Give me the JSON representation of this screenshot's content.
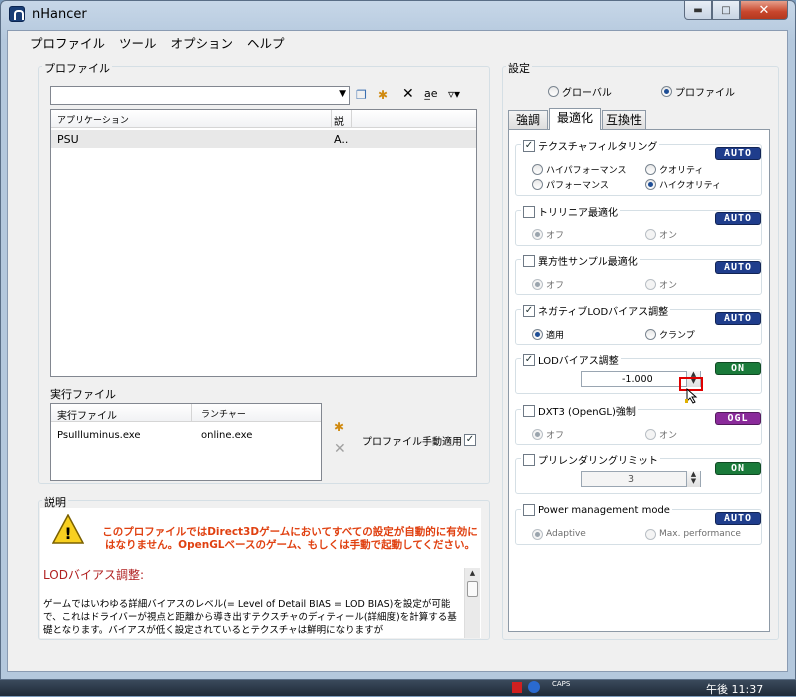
{
  "window": {
    "title": "nHancer"
  },
  "menu": [
    "プロファイル",
    "ツール",
    "オプション",
    "ヘルプ"
  ],
  "profile": {
    "group_label": "プロファイル",
    "combo_value": "",
    "columns": [
      "アプリケーション",
      "説"
    ],
    "rows": [
      {
        "app": "PSU",
        "desc": "A.."
      }
    ]
  },
  "exec": {
    "group_label": "実行ファイル",
    "columns": [
      "実行ファイル",
      "ランチャー"
    ],
    "rows": [
      {
        "file": "PsuIlluminus.exe",
        "launcher": "online.exe"
      }
    ],
    "auto_apply_label": "プロファイル手動適用",
    "auto_apply_checked": true
  },
  "desc": {
    "group_label": "説明",
    "warning": "このプロファイルではDirect3Dゲームにおいてすべての設定が自動的に有効に\nはなりません。OpenGLベースのゲーム、もしくは手動で起動してください。",
    "heading": "LODバイアス調整:",
    "body": "ゲームではいわゆる詳細バイアスのレベル(= Level of Detail BIAS = LOD BIAS)を設定が可能で、これはドライバーが視点と距離から導き出すテクスチャのディティール(詳細度)を計算する基礎となります。バイアスが低く設定されているとテクスチャは鮮明になりますが"
  },
  "settings": {
    "group_label": "設定",
    "scope_global": "グローバル",
    "scope_profile": "プロファイル",
    "scope_selected": "profile",
    "tabs": [
      "強調",
      "最適化",
      "互換性"
    ],
    "active_tab": "最適化"
  },
  "sections": {
    "texfilter": {
      "label": "テクスチャフィルタリング",
      "checked": true,
      "badge": "AUTO",
      "opt1": "ハイパフォーマンス",
      "opt2": "クオリティ",
      "opt3": "パフォーマンス",
      "opt4": "ハイクオリティ",
      "selected": "ハイクオリティ"
    },
    "trilinear": {
      "label": "トリリニア最適化",
      "checked": false,
      "badge": "AUTO",
      "off": "オフ",
      "on": "オン",
      "selected": "オフ"
    },
    "aniso": {
      "label": "異方性サンプル最適化",
      "checked": false,
      "badge": "AUTO",
      "off": "オフ",
      "on": "オン",
      "selected": "オフ"
    },
    "neglod": {
      "label": "ネガティブLODバイアス調整",
      "checked": true,
      "badge": "AUTO",
      "apply": "適用",
      "clamp": "クランプ",
      "selected": "適用"
    },
    "lodbias": {
      "label": "LODバイアス調整",
      "checked": true,
      "badge": "ON",
      "value": "-1.000"
    },
    "dxt3": {
      "label": "DXT3 (OpenGL)強制",
      "checked": false,
      "badge": "OGL",
      "off": "オフ",
      "on": "オン",
      "selected": "オフ"
    },
    "prerender": {
      "label": "プリレンダリングリミット",
      "checked": false,
      "badge": "ON",
      "value": "3"
    },
    "power": {
      "label": "Power management mode",
      "checked": false,
      "badge": "AUTO",
      "adaptive": "Adaptive",
      "maxperf": "Max. performance",
      "selected": "Adaptive"
    }
  },
  "colors": {
    "auto": "#1f3d8c",
    "on": "#1a7a3a",
    "ogl": "#8a2a9a",
    "warning": "#e04010",
    "highlight": "#e00000"
  },
  "taskbar": {
    "clock": "午後 11:37",
    "caps": "CAPS"
  }
}
